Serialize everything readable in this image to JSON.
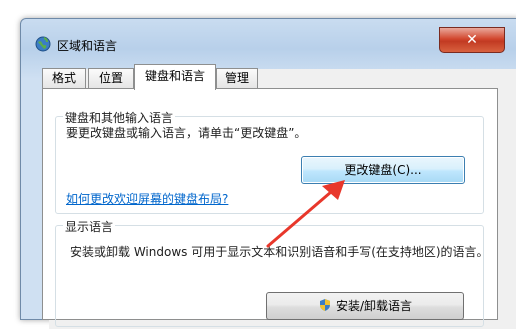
{
  "window": {
    "title": "区域和语言",
    "close_label": "✕"
  },
  "tabs": [
    {
      "label": "格式",
      "active": false
    },
    {
      "label": "位置",
      "active": false
    },
    {
      "label": "键盘和语言",
      "active": true
    },
    {
      "label": "管理",
      "active": false
    }
  ],
  "keyboard_group": {
    "title": "键盘和其他输入语言",
    "description": "要更改键盘或输入语言，请单击“更改键盘”。",
    "change_button_label": "更改键盘(C)...",
    "help_link": "如何更改欢迎屏幕的键盘布局?"
  },
  "display_language_group": {
    "title": "显示语言",
    "description": "安装或卸载 Windows 可用于显示文本和识别语音和手写(在支持地区)的语言。",
    "install_button_label": "安装/卸载语言"
  },
  "colors": {
    "accent_arrow": "#e8372b",
    "link": "#0066cc"
  }
}
